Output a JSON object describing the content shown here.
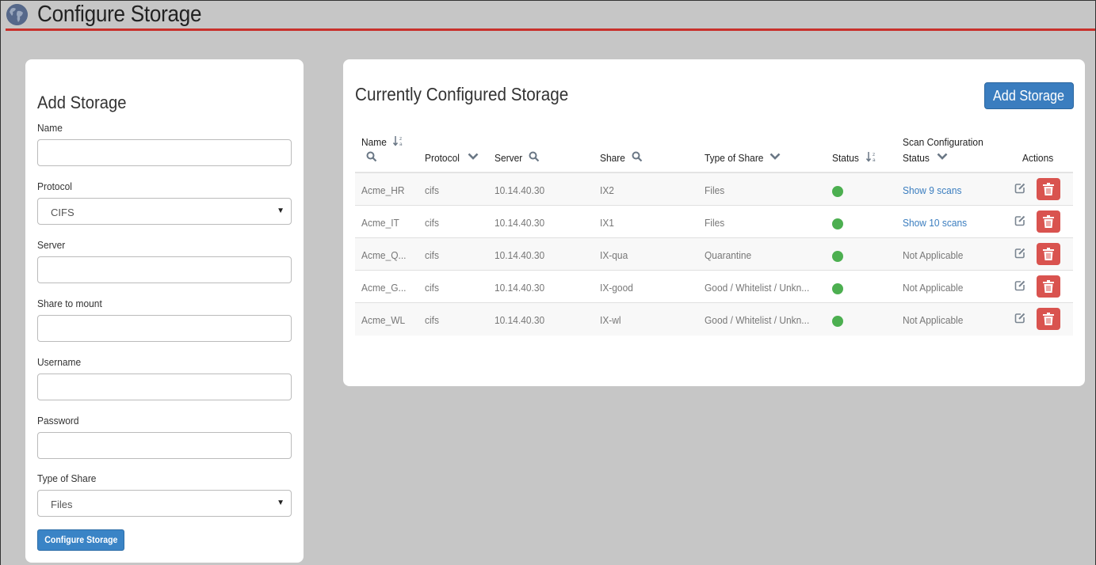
{
  "header": {
    "title": "Configure Storage"
  },
  "add_form": {
    "title": "Add Storage",
    "fields": {
      "name": {
        "label": "Name",
        "value": ""
      },
      "protocol": {
        "label": "Protocol",
        "value": "CIFS"
      },
      "server": {
        "label": "Server",
        "value": ""
      },
      "share": {
        "label": "Share to mount",
        "value": ""
      },
      "username": {
        "label": "Username",
        "value": ""
      },
      "password": {
        "label": "Password",
        "value": ""
      },
      "type_of_share": {
        "label": "Type of Share",
        "value": "Files"
      }
    },
    "submit_label": "Configure Storage"
  },
  "storage_list": {
    "title": "Currently Configured Storage",
    "add_label": "Add Storage",
    "columns": {
      "name": "Name",
      "protocol": "Protocol",
      "server": "Server",
      "share": "Share",
      "type": "Type of Share",
      "status": "Status",
      "scan_line1": "Scan Configuration",
      "scan_line2": "Status",
      "actions": "Actions"
    },
    "rows": [
      {
        "name": "Acme_HR",
        "protocol": "cifs",
        "server": "10.14.40.30",
        "share": "IX2",
        "type": "Files",
        "scan": "Show 9 scans",
        "scan_link": true
      },
      {
        "name": "Acme_IT",
        "protocol": "cifs",
        "server": "10.14.40.30",
        "share": "IX1",
        "type": "Files",
        "scan": "Show 10 scans",
        "scan_link": true
      },
      {
        "name": "Acme_Q...",
        "protocol": "cifs",
        "server": "10.14.40.30",
        "share": "IX-qua",
        "type": "Quarantine",
        "scan": "Not Applicable",
        "scan_link": false
      },
      {
        "name": "Acme_G...",
        "protocol": "cifs",
        "server": "10.14.40.30",
        "share": "IX-good",
        "type": "Good / Whitelist / Unkn...",
        "scan": "Not Applicable",
        "scan_link": false
      },
      {
        "name": "Acme_WL",
        "protocol": "cifs",
        "server": "10.14.40.30",
        "share": "IX-wl",
        "type": "Good / Whitelist / Unkn...",
        "scan": "Not Applicable",
        "scan_link": false
      }
    ]
  },
  "colors": {
    "accent": "#3a7dbf",
    "danger": "#d9534f",
    "status_ok": "#4caf50",
    "header_rule": "#c8302b"
  }
}
